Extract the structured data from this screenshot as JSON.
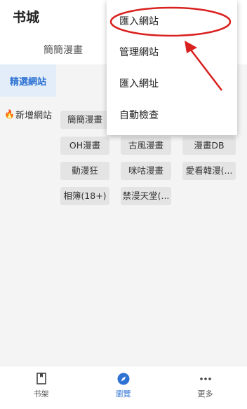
{
  "header": {
    "title": "书城",
    "tab": "簡簡漫畫"
  },
  "sidebar": {
    "items": [
      {
        "label": "精選網站",
        "active": true
      },
      {
        "label": "新增網站",
        "icon": "fire-icon"
      }
    ]
  },
  "content": {
    "chips": [
      "簡簡漫畫",
      "OH漫畫",
      "古風漫畫",
      "漫畫DB",
      "動漫狂",
      "咪咕漫畫",
      "愛看韓漫(...",
      "相簿(18+)",
      "禁漫天堂(..."
    ]
  },
  "menu": {
    "items": [
      "匯入網站",
      "管理網站",
      "匯入網址",
      "自動檢查"
    ]
  },
  "bottom_nav": {
    "items": [
      {
        "label": "书架",
        "icon": "bookmark-icon"
      },
      {
        "label": "瀏覽",
        "icon": "compass-icon",
        "active": true
      },
      {
        "label": "更多",
        "icon": "more-icon"
      }
    ]
  },
  "colors": {
    "accent": "#2e73d3",
    "annotation": "#d9211f"
  }
}
